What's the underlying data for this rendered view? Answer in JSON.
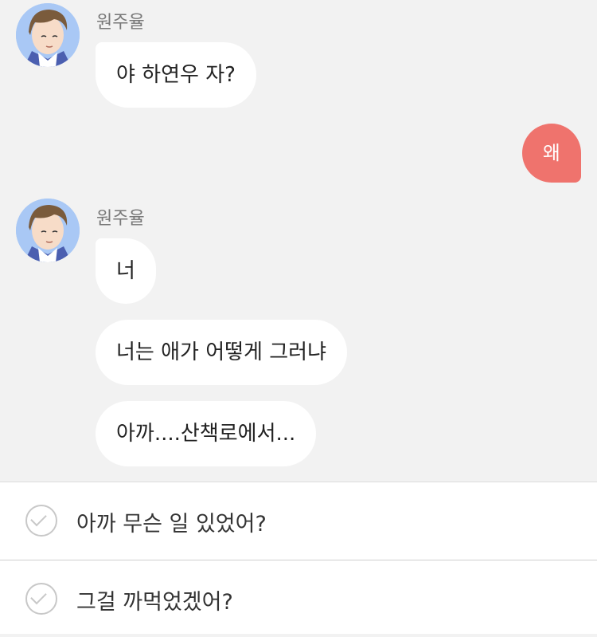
{
  "chat": {
    "messages": [
      {
        "sender": "원주율",
        "text": "야 하연우 자?"
      },
      {
        "mine": true,
        "text": "왜"
      },
      {
        "sender": "원주율",
        "text": "너"
      },
      {
        "text": "너는 애가 어떻게 그러냐"
      },
      {
        "text": "아까....산책로에서..."
      }
    ]
  },
  "choices": [
    {
      "label": "아까 무슨 일 있었어?"
    },
    {
      "label": "그걸 까먹었겠어?"
    }
  ],
  "colors": {
    "my_bubble": "#ef736d",
    "their_bubble": "#ffffff",
    "background": "#f2f2f2"
  }
}
